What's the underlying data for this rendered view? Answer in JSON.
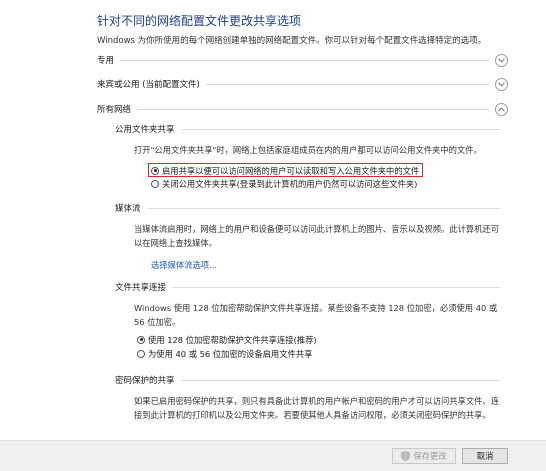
{
  "page": {
    "title": "针对不同的网络配置文件更改共享选项",
    "subtitle": "Windows 为你所使用的每个网络创建单独的网络配置文件。你可以针对每个配置文件选择特定的选项。"
  },
  "sections": {
    "private": {
      "label": "专用",
      "expanded": false
    },
    "guest_public": {
      "label": "来宾或公用 (当前配置文件)",
      "expanded": false
    },
    "all_networks": {
      "label": "所有网络",
      "expanded": true
    }
  },
  "public_folder_sharing": {
    "heading": "公用文件夹共享",
    "description": "打开\"公用文件夹共享\"时，网络上包括家庭组成员在内的用户都可以访问公用文件夹中的文件。",
    "options": [
      {
        "label": "启用共享以便可以访问网络的用户可以读取和写入公用文件夹中的文件",
        "selected": true
      },
      {
        "label": "关闭公用文件夹共享(登录到此计算机的用户仍然可以访问这些文件夹)",
        "selected": false
      }
    ]
  },
  "media_streaming": {
    "heading": "媒体流",
    "description": "当媒体流启用时，网络上的用户和设备便可以访问此计算机上的图片、音乐以及视频。此计算机还可以在网络上查找媒体。",
    "link": "选择媒体流选项..."
  },
  "file_sharing_connections": {
    "heading": "文件共享连接",
    "description": "Windows 使用 128 位加密帮助保护文件共享连接。某些设备不支持 128 位加密，必须使用 40 或 56 位加密。",
    "options": [
      {
        "label": "使用 128 位加密帮助保护文件共享连接(推荐)",
        "selected": true
      },
      {
        "label": "为使用 40 或 56 位加密的设备启用文件共享",
        "selected": false
      }
    ]
  },
  "password_protected_sharing": {
    "heading": "密码保护的共享",
    "description": "如果已启用密码保护的共享，则只有具备此计算机的用户帐户和密码的用户才可以访问共享文件、连接到此计算机的打印机以及公用文件夹。若要使其他人具备访问权限，必须关闭密码保护的共享。"
  },
  "footer": {
    "save_label": "保存更改",
    "cancel_label": "取消"
  },
  "colors": {
    "title": "#1e3f8f",
    "link": "#1a56c8",
    "highlight": "#d9272e"
  }
}
